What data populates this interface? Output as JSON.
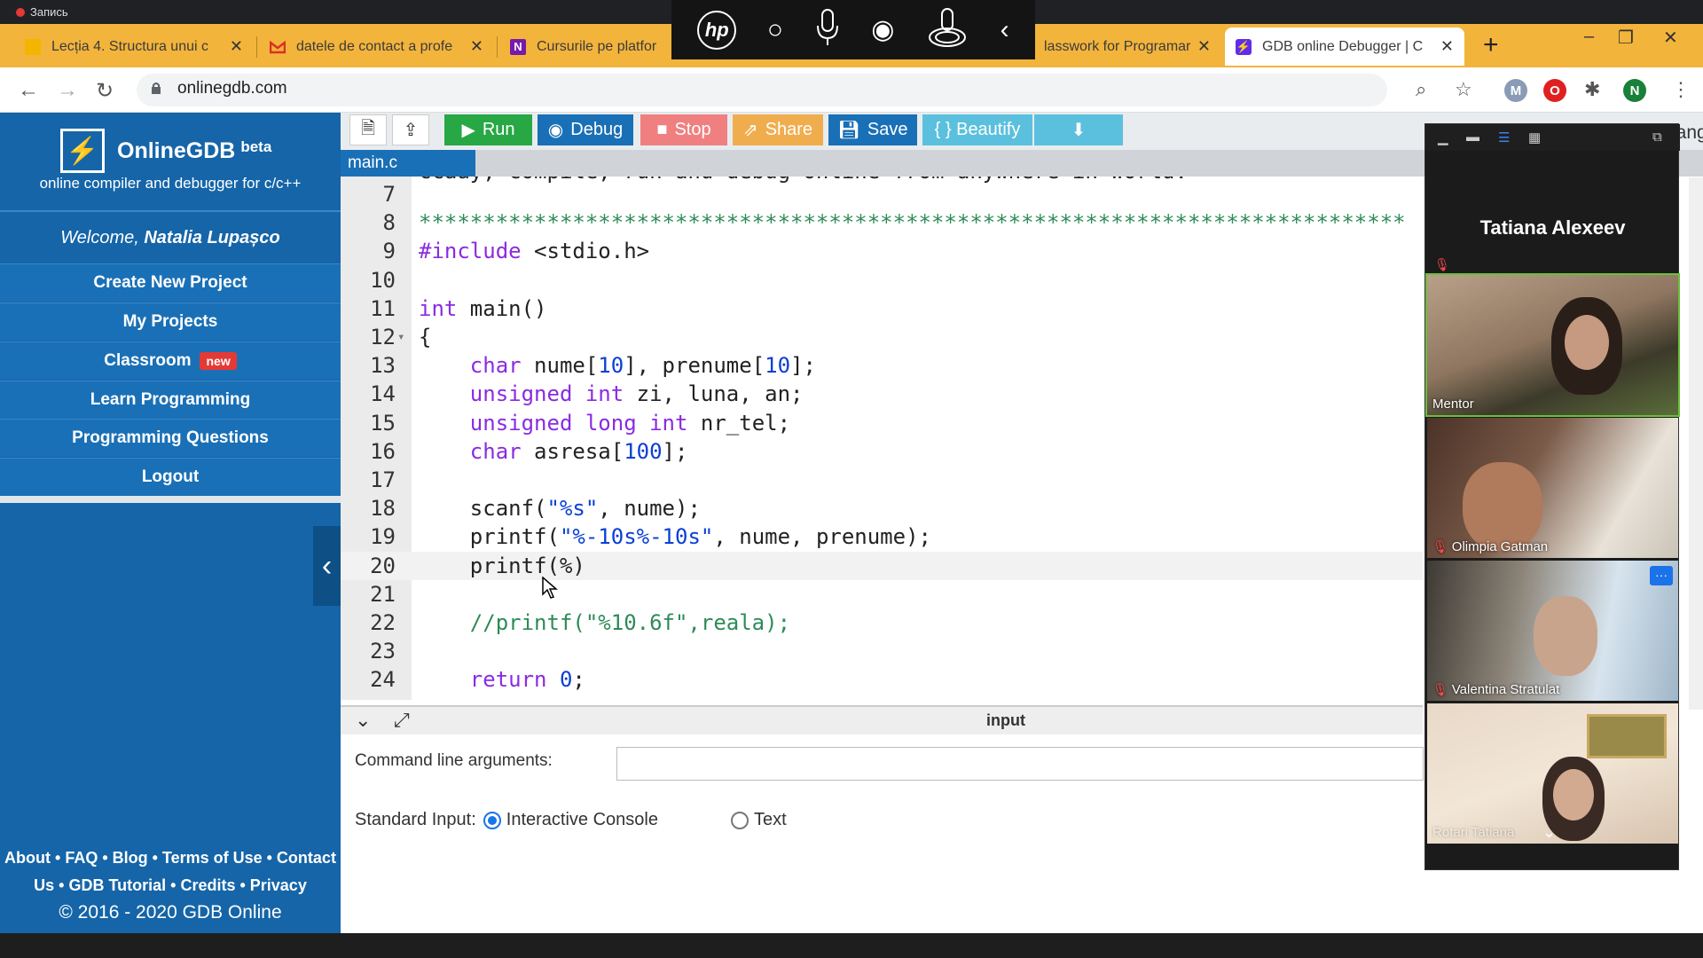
{
  "recording": {
    "label": "Запись"
  },
  "tabs": [
    {
      "title": "Lecția 4. Structura unui c",
      "icon": "slides-icon",
      "color": "#f4b400"
    },
    {
      "title": "datele de contact a profe",
      "icon": "gmail-icon",
      "color": "#d93025"
    },
    {
      "title": "Cursurile pe platfor",
      "icon": "onenote-icon",
      "color": "#7719aa"
    },
    {
      "title": "lasswork for Programar",
      "icon": "classroom-icon",
      "color": "#188038"
    },
    {
      "title": "GDB online Debugger | C",
      "icon": "gdb-icon",
      "color": "#5f2eea"
    }
  ],
  "address": {
    "url": "onlinegdb.com"
  },
  "profile_letter": "N",
  "ext_letter": "M",
  "sidebar": {
    "brand": "OnlineGDB",
    "beta": "beta",
    "tagline": "online compiler and debugger for c/c++",
    "welcome_prefix": "Welcome,",
    "user": "Natalia Lupașco",
    "menu": [
      {
        "label": "Create New Project"
      },
      {
        "label": "My Projects"
      },
      {
        "label": "Classroom",
        "badge": "new"
      },
      {
        "label": "Learn Programming"
      },
      {
        "label": "Programming Questions"
      },
      {
        "label": "Logout"
      }
    ],
    "footer_line1": "About • FAQ • Blog • Terms of Use • Contact",
    "footer_line2": "Us • GDB Tutorial • Credits • Privacy",
    "copyright": "© 2016 - 2020 GDB Online"
  },
  "toolbar": {
    "run": "Run",
    "debug": "Debug",
    "stop": "Stop",
    "share": "Share",
    "save": "Save",
    "beautify": "{ } Beautify",
    "language_label": "Language",
    "colors": {
      "run": "#28a745",
      "debug": "#1a70b6",
      "stop": "#f08080",
      "share": "#f0ad4e",
      "save": "#1a70b6",
      "beautify": "#5bc0de",
      "download": "#5bc0de"
    }
  },
  "editor": {
    "file_tab": "main.c",
    "partial_line": "ccaay, compile, run and debug online from anywhere in world.",
    "lines": [
      {
        "n": "7",
        "html": ""
      },
      {
        "n": "8",
        "stars": "*****************************************************************************"
      },
      {
        "n": "9",
        "include": "#include",
        "rest": " <stdio.h>"
      },
      {
        "n": "10"
      },
      {
        "n": "11",
        "kw": "int",
        "rest": " main()"
      },
      {
        "n": "12",
        "rest": "{",
        "fold": true
      },
      {
        "n": "13",
        "code": "char nume[10], prenume[10];"
      },
      {
        "n": "14",
        "code": "unsigned int zi, luna, an;"
      },
      {
        "n": "15",
        "code": "unsigned long int nr_tel;"
      },
      {
        "n": "16",
        "code": "char asresa[100];"
      },
      {
        "n": "17"
      },
      {
        "n": "18",
        "code": "scanf(\"%s\", nume);"
      },
      {
        "n": "19",
        "code": "printf(\"%-10s%-10s\", nume, prenume);"
      },
      {
        "n": "20",
        "code": "printf(%)",
        "active": true
      },
      {
        "n": "21"
      },
      {
        "n": "22",
        "comment": "//printf(\"%10.6f\",reala);"
      },
      {
        "n": "23"
      },
      {
        "n": "24",
        "code": "return 0;"
      }
    ]
  },
  "io": {
    "title": "input",
    "cla_label": "Command line arguments:",
    "stdin_label": "Standard Input:",
    "opt_interactive": "Interactive Console",
    "opt_text": "Text"
  },
  "zoom": {
    "speaker": "Tatiana Alexeev",
    "participants": [
      {
        "name": "Mentor",
        "muted": false
      },
      {
        "name": "Olimpia Gatman",
        "muted": true
      },
      {
        "name": "Valentina Stratulat",
        "muted": true
      },
      {
        "name": "Rotari Tatiana",
        "muted": false
      }
    ]
  }
}
